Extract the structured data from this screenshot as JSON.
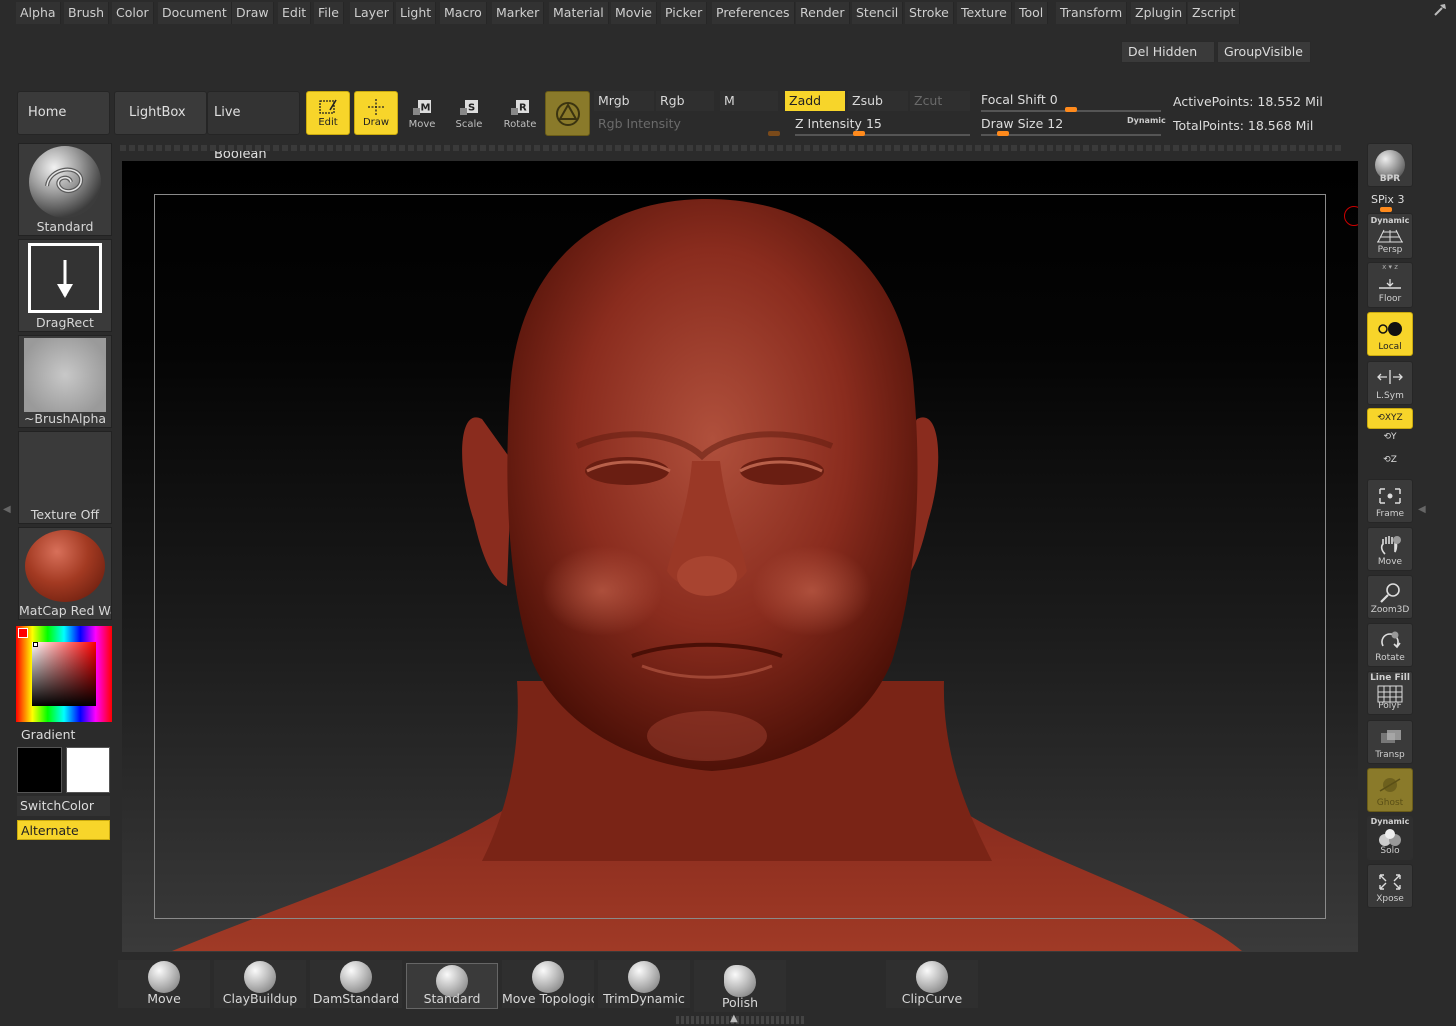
{
  "menu": [
    "Alpha",
    "Brush",
    "Color",
    "Document",
    "Draw",
    "Edit",
    "File",
    "Layer",
    "Light",
    "Macro",
    "Marker",
    "Material",
    "Movie",
    "Picker",
    "Preferences",
    "Render",
    "Stencil",
    "Stroke",
    "Texture",
    "Tool",
    "Transform",
    "Zplugin",
    "Zscript"
  ],
  "strip": {
    "del_hidden": "Del Hidden",
    "group_visible": "GroupVisible"
  },
  "toolbar": {
    "home_page": "Home Page",
    "lightbox": "LightBox",
    "live_boolean": "Live Boolean",
    "edit": "Edit",
    "draw": "Draw",
    "move": "Move",
    "scale": "Scale",
    "rotate": "Rotate",
    "mrgb": "Mrgb",
    "rgb": "Rgb",
    "m": "M",
    "rgb_intensity": "Rgb Intensity",
    "zadd": "Zadd",
    "zsub": "Zsub",
    "zcut": "Zcut",
    "z_intensity_label": "Z Intensity",
    "z_intensity_value": "15",
    "focal_shift_label": "Focal Shift",
    "focal_shift_value": "0",
    "draw_size_label": "Draw Size",
    "draw_size_value": "12",
    "dynamic": "Dynamic",
    "active_points": "ActivePoints: 18.552 Mil",
    "total_points": "TotalPoints: 18.568 Mil"
  },
  "left_panel": {
    "brush": "Standard",
    "stroke": "DragRect",
    "alpha": "~BrushAlpha",
    "texture": "Texture Off",
    "material": "MatCap Red Wax",
    "gradient": "Gradient",
    "switch_color": "SwitchColor",
    "alternate": "Alternate"
  },
  "right_shelf": {
    "bpr": "BPR",
    "spix_label": "SPix",
    "spix_value": "3",
    "dynamic": "Dynamic",
    "persp": "Persp",
    "floor": "Floor",
    "local": "Local",
    "lsym": "L.Sym",
    "xyz": "XYZ",
    "y": "Y",
    "z": "Z",
    "frame": "Frame",
    "move": "Move",
    "zoom3d": "Zoom3D",
    "rotate": "Rotate",
    "line_fill": "Line Fill",
    "polyf": "PolyF",
    "transp": "Transp",
    "ghost": "Ghost",
    "dynamic2": "Dynamic",
    "solo": "Solo",
    "xpose": "Xpose"
  },
  "brush_shelf": [
    "Move",
    "ClayBuildup",
    "DamStandard",
    "Standard",
    "Move Topological",
    "TrimDynamic",
    "Polish",
    "ClipCurve"
  ],
  "colors": {
    "accent": "#f7d52a",
    "slider": "#ff8a1c",
    "skin": "#8a2c1e"
  }
}
